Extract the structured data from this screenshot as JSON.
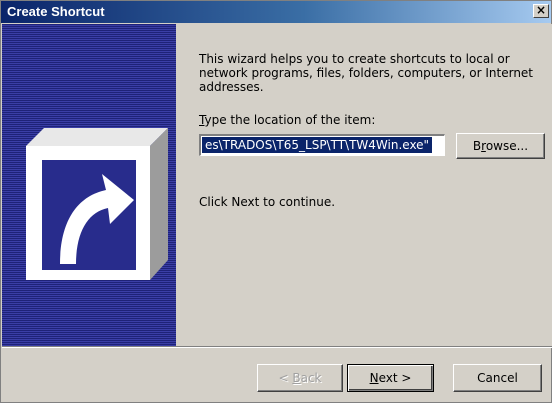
{
  "window": {
    "title": "Create Shortcut",
    "close_glyph": "×"
  },
  "banner": {
    "icon": "shortcut-arrow-icon"
  },
  "main": {
    "intro": "This wizard helps you to create shortcuts to local or network programs, files, folders, computers, or Internet addresses.",
    "location_label_mnemonic": "T",
    "location_label_rest": "ype the location of the item:",
    "location_value": "es\\TRADOS\\T65_LSP\\TT\\TW4Win.exe\"",
    "browse_pre": "B",
    "browse_mnemonic": "r",
    "browse_post": "owse...",
    "continue_text": "Click Next to continue."
  },
  "footer": {
    "back_pre": "< ",
    "back_mnemonic": "B",
    "back_post": "ack",
    "next_mnemonic": "N",
    "next_post": "ext >",
    "cancel_label": "Cancel"
  },
  "colors": {
    "title_bar": "#0a246a",
    "banner": "#282c8c",
    "selection": "#0a246a",
    "dialog_face": "#d4d0c8"
  }
}
